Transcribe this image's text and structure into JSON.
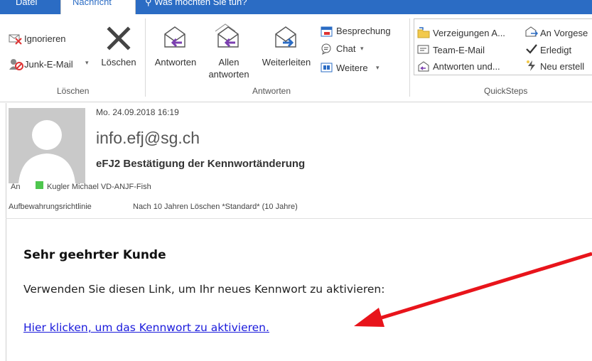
{
  "tabs": {
    "file": "Datei",
    "message": "Nachricht",
    "tell_me": "Was möchten Sie tun?"
  },
  "ribbon": {
    "delete_group": {
      "ignore": "Ignorieren",
      "junk": "Junk-E-Mail",
      "delete": "Löschen",
      "group_label": "Löschen"
    },
    "respond_group": {
      "reply": "Antworten",
      "reply_all_line1": "Allen",
      "reply_all_line2": "antworten",
      "forward": "Weiterleiten",
      "meeting": "Besprechung",
      "chat": "Chat",
      "more": "Weitere",
      "group_label": "Antworten"
    },
    "quicksteps_group": {
      "moves": "Verzeigungen A...",
      "team_email": "Team-E-Mail",
      "reply_delete": "Antworten und...",
      "to_manager": "An Vorgese",
      "done": "Erledigt",
      "create_new": "Neu erstell",
      "group_label": "QuickSteps"
    }
  },
  "message": {
    "date": "Mo. 24.09.2018 16:19",
    "sender": "info.efj@sg.ch",
    "subject": "eFJ2 Bestätigung der Kennwortänderung",
    "to_label": "An",
    "to_name": "Kugler Michael VD-ANJF-Fish",
    "retention_label": "Aufbewahrungsrichtlinie",
    "retention_value": "Nach 10 Jahren Löschen *Standard* (10 Jahre)"
  },
  "body": {
    "greeting": "Sehr geehrter Kunde",
    "instruction": "Verwenden Sie diesen Link, um Ihr neues Kennwort zu aktivieren:",
    "link_text": "Hier klicken, um das Kennwort zu aktivieren."
  },
  "colors": {
    "accent": "#2b6cc4",
    "link": "#1a1adc",
    "annotation_arrow": "#e8141b",
    "presence": "#4ec64e"
  }
}
